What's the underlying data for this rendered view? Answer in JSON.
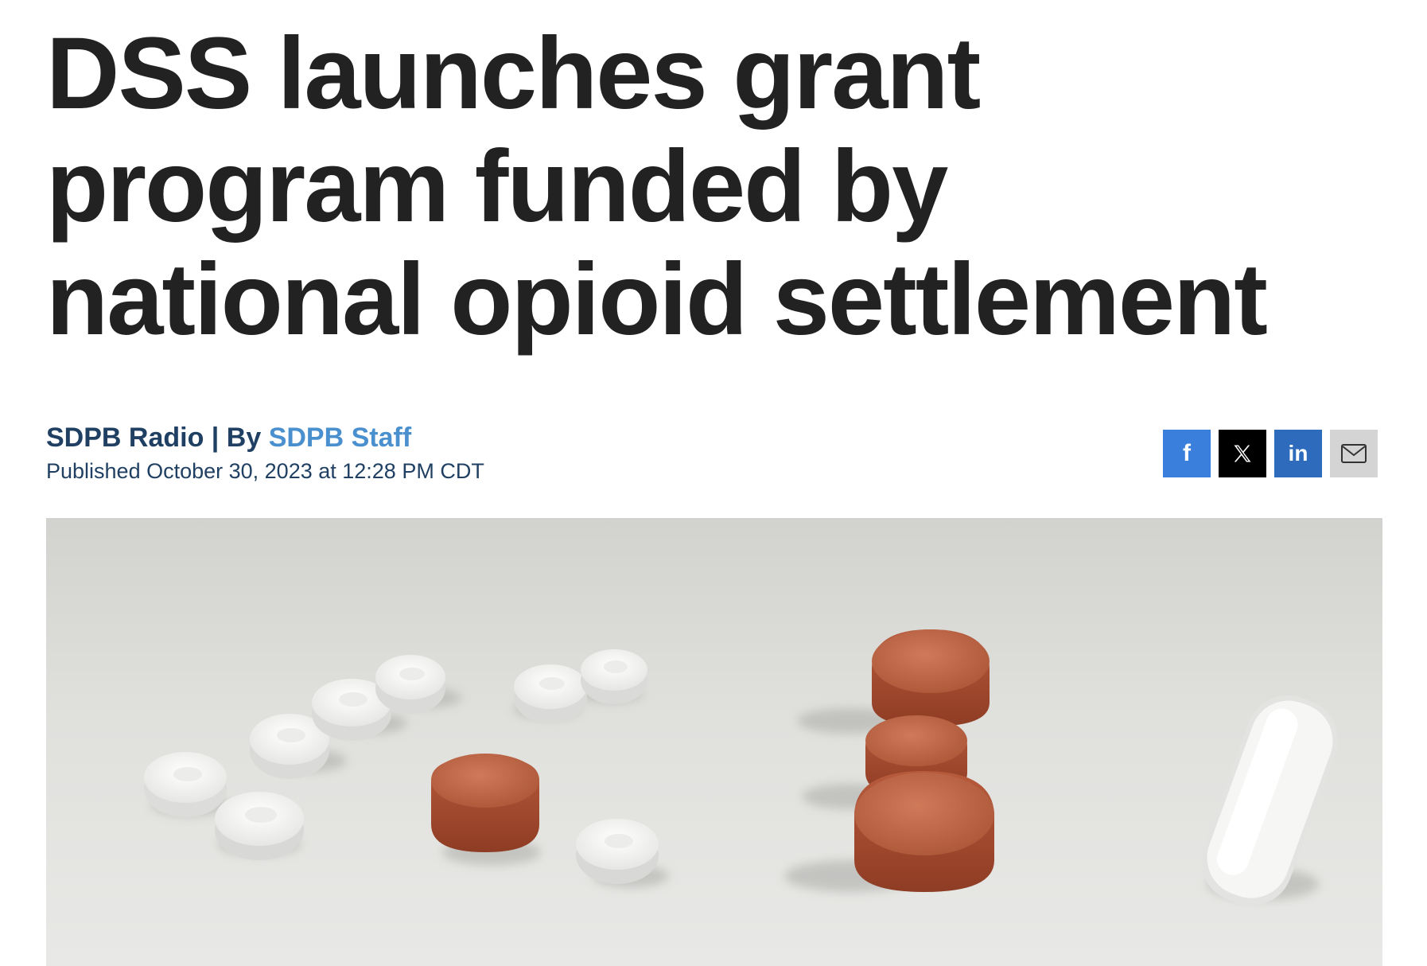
{
  "article": {
    "headline": "DSS launches grant program funded by national opioid settlement",
    "byline": {
      "source": "SDPB Radio",
      "separator": " | By ",
      "author": "SDPB Staff"
    },
    "published": "Published October 30, 2023 at 12:28 PM CDT"
  },
  "share": {
    "facebook": {
      "icon": "facebook-icon",
      "color": "#3b7fdc",
      "glyph": "f"
    },
    "x": {
      "icon": "x-icon",
      "color": "#000000"
    },
    "linkedin": {
      "icon": "linkedin-icon",
      "color": "#2f6bbd",
      "glyph": "in"
    },
    "email": {
      "icon": "mail-icon",
      "color": "#d4d4d4"
    }
  },
  "hero_image": {
    "subject": "pills-photo"
  },
  "colors": {
    "headline": "#222222",
    "byline": "#1f3f63",
    "author_link": "#4a8fce"
  }
}
